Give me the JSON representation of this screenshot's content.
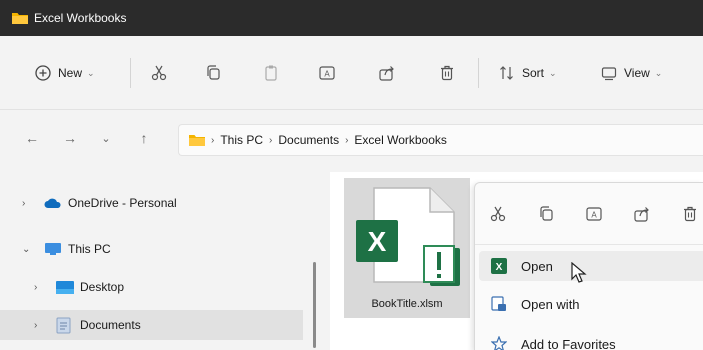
{
  "window": {
    "title": "Excel Workbooks",
    "icon": "folder-icon"
  },
  "toolbar": {
    "new_label": "New",
    "sort_label": "Sort",
    "view_label": "View",
    "icons": [
      "plus-circle-icon",
      "cut-icon",
      "copy-icon",
      "paste-icon",
      "rename-icon",
      "share-icon",
      "delete-icon",
      "sort-icon",
      "view-icon"
    ]
  },
  "address": {
    "crumbs": [
      "This PC",
      "Documents",
      "Excel Workbooks"
    ]
  },
  "nav": {
    "items": [
      {
        "label": "OneDrive - Personal",
        "icon": "cloud-icon",
        "expander": "›"
      },
      {
        "label": "This PC",
        "icon": "monitor-icon",
        "expander": "⌄"
      },
      {
        "label": "Desktop",
        "icon": "desktop-icon",
        "expander": "›"
      },
      {
        "label": "Documents",
        "icon": "documents-icon",
        "expander": "›"
      }
    ]
  },
  "file": {
    "name": "BookTitle.xlsm",
    "icon": "excel-macro-file-icon",
    "badge": "X"
  },
  "context_menu": {
    "top_icons": [
      "cut-icon",
      "copy-icon",
      "rename-icon",
      "share-icon",
      "delete-icon"
    ],
    "items": [
      {
        "label": "Open",
        "icon": "excel-icon"
      },
      {
        "label": "Open with",
        "icon": "open-with-icon"
      },
      {
        "label": "Add to Favorites",
        "icon": "star-icon"
      }
    ]
  },
  "colors": {
    "excel_green": "#1e7145",
    "folder_yellow": "#f4b400",
    "onedrive_blue": "#0f6cbd",
    "accent_blue": "#3b8ee0"
  }
}
